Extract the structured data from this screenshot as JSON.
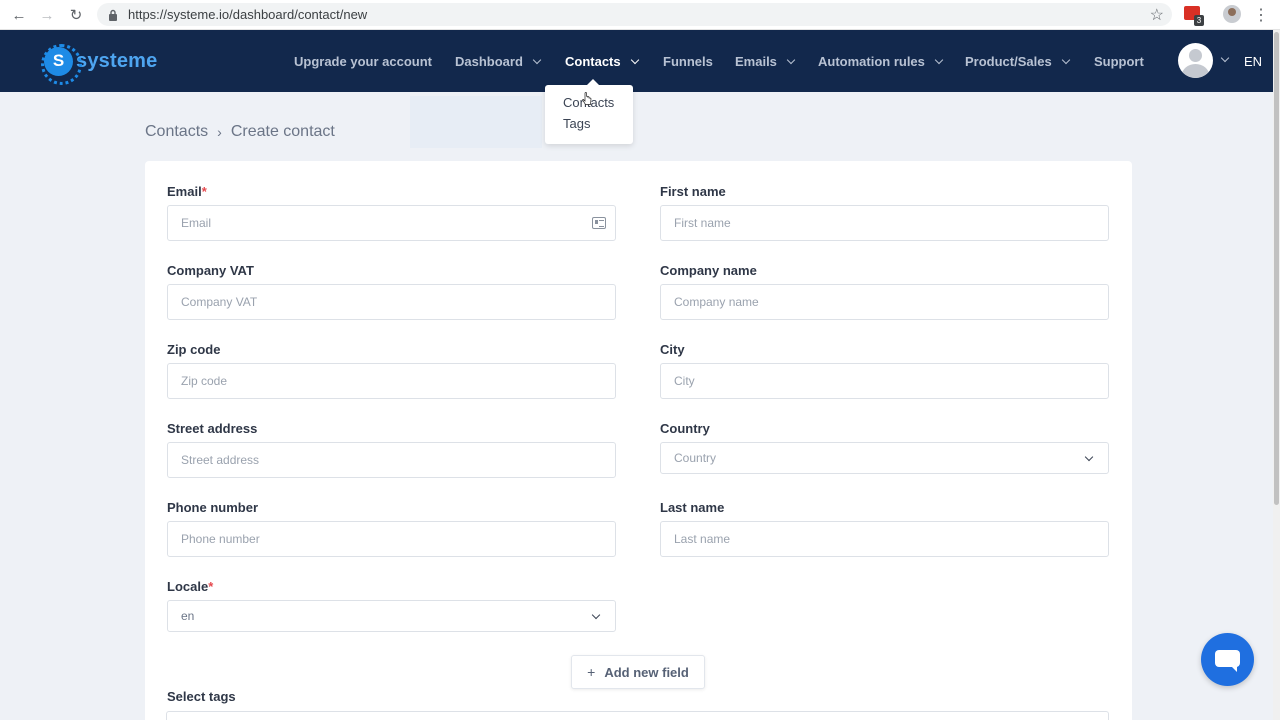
{
  "browser": {
    "back_icon": "←",
    "forward_icon": "→",
    "reload_icon": "↻",
    "url": "https://systeme.io/dashboard/contact/new",
    "star_icon": "☆",
    "ext_badge": "3",
    "menu_icon": "⋮"
  },
  "brand": {
    "logo_letter": "S",
    "name": "systeme"
  },
  "nav": {
    "items": [
      {
        "label": "Upgrade your account",
        "caret": false,
        "active": false
      },
      {
        "label": "Dashboard",
        "caret": true,
        "active": false
      },
      {
        "label": "Contacts",
        "caret": true,
        "active": true
      },
      {
        "label": "Funnels",
        "caret": false,
        "active": false
      },
      {
        "label": "Emails",
        "caret": true,
        "active": false
      },
      {
        "label": "Automation rules",
        "caret": true,
        "active": false
      },
      {
        "label": "Product/Sales",
        "caret": true,
        "active": false
      },
      {
        "label": "Support",
        "caret": false,
        "active": false
      }
    ],
    "language": "EN"
  },
  "dropdown": {
    "items": [
      "Contacts",
      "Tags"
    ]
  },
  "breadcrumb": {
    "parent": "Contacts",
    "separator": "›",
    "current": "Create contact"
  },
  "form": {
    "email": {
      "label": "Email",
      "required": "*",
      "placeholder": "Email"
    },
    "first_name": {
      "label": "First name",
      "placeholder": "First name"
    },
    "company_vat": {
      "label": "Company VAT",
      "placeholder": "Company VAT"
    },
    "company_name": {
      "label": "Company name",
      "placeholder": "Company name"
    },
    "zip": {
      "label": "Zip code",
      "placeholder": "Zip code"
    },
    "city": {
      "label": "City",
      "placeholder": "City"
    },
    "street": {
      "label": "Street address",
      "placeholder": "Street address"
    },
    "country": {
      "label": "Country",
      "value": "Country"
    },
    "phone": {
      "label": "Phone number",
      "placeholder": "Phone number"
    },
    "last_name": {
      "label": "Last name",
      "placeholder": "Last name"
    },
    "locale": {
      "label": "Locale",
      "required": "*",
      "value": "en"
    },
    "add_field": {
      "plus": "+",
      "label": "Add new field"
    },
    "select_tags": {
      "label": "Select tags"
    }
  },
  "colors": {
    "nav_bg": "#12284c",
    "brand_blue": "#1e8be6",
    "page_bg": "#eef1f6",
    "chat_blue": "#1f6fe0",
    "required_red": "#e5484d"
  }
}
